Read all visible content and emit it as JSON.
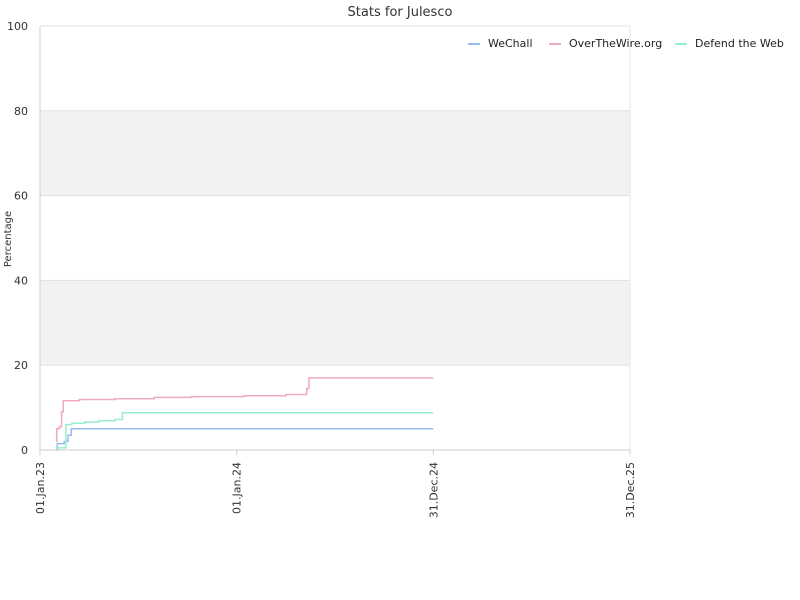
{
  "chart_data": {
    "type": "line",
    "title": "Stats for Julesco",
    "xlabel": "",
    "ylabel": "Percentage",
    "x_ticks": [
      "01.Jan.23",
      "01.Jan.24",
      "31.Dec.24",
      "31.Dec.25"
    ],
    "y_ticks": [
      "0",
      "20",
      "40",
      "60",
      "80",
      "100"
    ],
    "xlim": [
      "2023-01-01",
      "2025-12-31"
    ],
    "ylim": [
      0,
      100
    ],
    "grid": "horizontal bands",
    "legend_position": "top-right",
    "series": [
      {
        "name": "WeChall",
        "color": "#99bbee",
        "points": [
          [
            "2023-02-01",
            0
          ],
          [
            "2023-02-02",
            1.5
          ],
          [
            "2023-02-15",
            2
          ],
          [
            "2023-02-22",
            3.5
          ],
          [
            "2023-02-28",
            5
          ],
          [
            "2024-12-31",
            5
          ]
        ]
      },
      {
        "name": "OverTheWire.org",
        "color": "#eea8c8",
        "points": [
          [
            "2023-01-31",
            2
          ],
          [
            "2023-02-01",
            5
          ],
          [
            "2023-02-06",
            5.5
          ],
          [
            "2023-02-10",
            9
          ],
          [
            "2023-02-13",
            11.6
          ],
          [
            "2023-03-15",
            11.9
          ],
          [
            "2023-05-20",
            12.1
          ],
          [
            "2023-08-01",
            12.4
          ],
          [
            "2023-10-10",
            12.6
          ],
          [
            "2024-01-15",
            12.8
          ],
          [
            "2024-04-01",
            13.1
          ],
          [
            "2024-05-10",
            14.5
          ],
          [
            "2024-05-14",
            17
          ],
          [
            "2024-12-31",
            17
          ]
        ]
      },
      {
        "name": "Defend the Web",
        "color": "#99eecc",
        "points": [
          [
            "2023-02-02",
            0.5
          ],
          [
            "2023-02-18",
            6
          ],
          [
            "2023-03-01",
            6.3
          ],
          [
            "2023-03-25",
            6.6
          ],
          [
            "2023-04-20",
            6.9
          ],
          [
            "2023-05-20",
            7.2
          ],
          [
            "2023-06-03",
            8.8
          ],
          [
            "2024-12-31",
            8.8
          ]
        ]
      }
    ]
  }
}
